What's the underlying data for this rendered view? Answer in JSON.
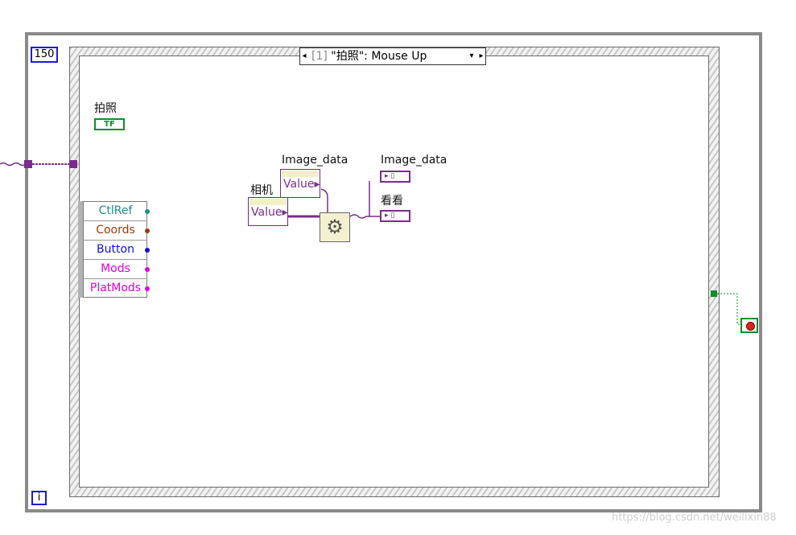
{
  "window": {
    "background": "#ffffff"
  },
  "while_loop": {
    "count_terminal": "150",
    "timeout_icon": "hourglass-icon",
    "iteration_label": "i",
    "stop_terminal_icon": "stop-icon"
  },
  "event_structure": {
    "case_index": "[1]",
    "case_label": "\"拍照\": Mouse Up",
    "prev_arrow": "◂",
    "dropdown_arrow": "▾",
    "next_arrow": "▸",
    "event_data_node": [
      "CtlRef",
      "Coords",
      "Button",
      "Mods",
      "PlatMods"
    ],
    "event_data_colors": [
      "#1f8d8d",
      "#9a3b0a",
      "#1010d0",
      "#e000e0",
      "#e000e0"
    ]
  },
  "controls": {
    "button_label": "拍照",
    "button_terminal": "TF"
  },
  "property_nodes": {
    "camera": {
      "label": "相机",
      "value": "Value▸"
    },
    "image": {
      "label": "Image_data",
      "value": "Value▸"
    }
  },
  "subvi": {
    "icon": "gear-save-icon",
    "glyph": "⚙"
  },
  "indicators": [
    {
      "label": "Image_data",
      "glyph": "▸ ▯"
    },
    {
      "label": "看看",
      "glyph": "▸ ▯"
    }
  ],
  "watermark": "https://blog.csdn.net/weilixin88",
  "colors": {
    "wire_purple": "#7b2c8c",
    "wire_green": "#0e8f2a",
    "frame_blue": "#1b1bdc"
  }
}
